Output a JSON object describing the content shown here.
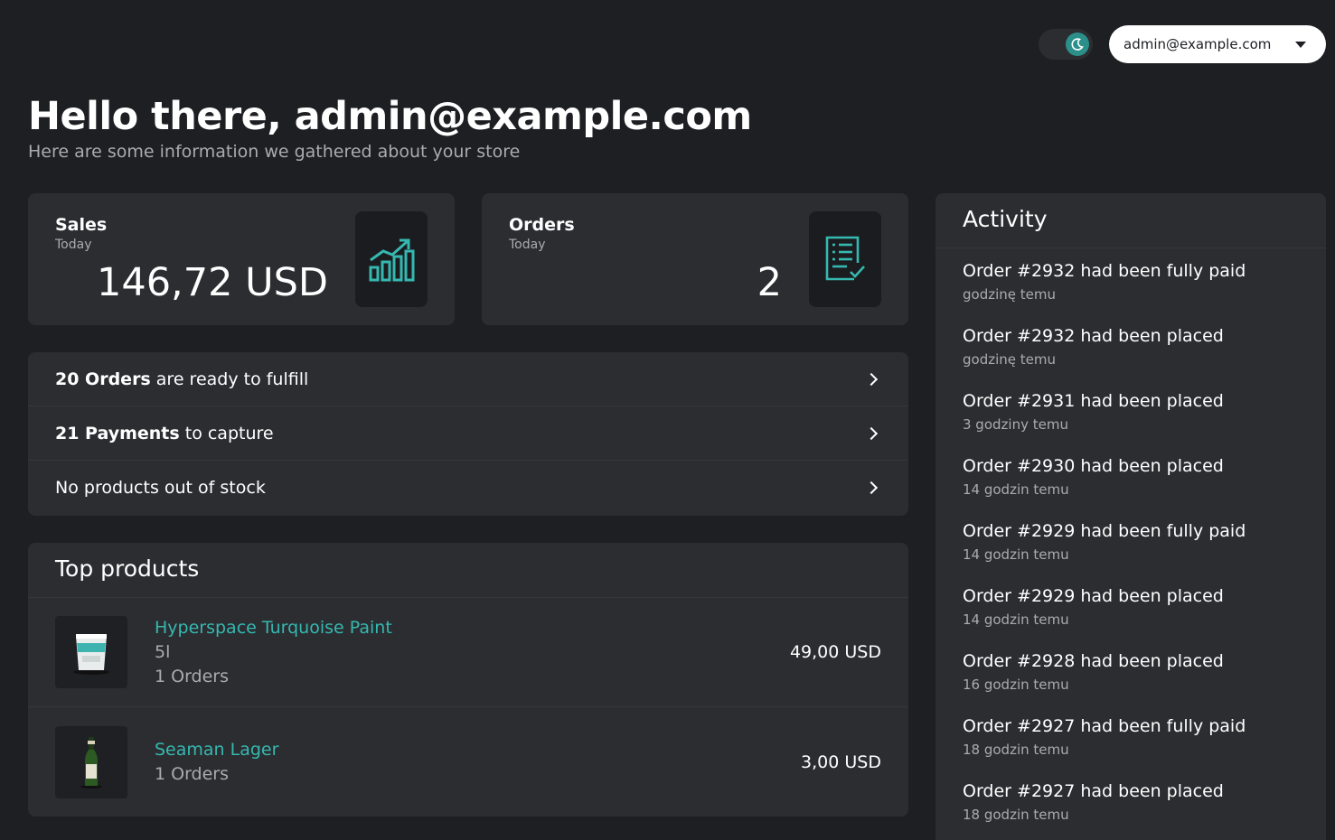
{
  "topbar": {
    "theme_toggle_icon": "moon-icon",
    "user_email": "admin@example.com"
  },
  "header": {
    "greeting": "Hello there, admin@example.com",
    "subtitle": "Here are some information we gathered about your store"
  },
  "stats": {
    "sales": {
      "title": "Sales",
      "period": "Today",
      "value": "146,72 USD",
      "icon": "chart-growth-icon"
    },
    "orders": {
      "title": "Orders",
      "period": "Today",
      "value": "2",
      "icon": "checklist-icon"
    }
  },
  "summary": {
    "fulfill_count": "20 Orders",
    "fulfill_text": " are ready to fulfill",
    "capture_count": "21 Payments",
    "capture_text": " to capture",
    "stock_text": "No products out of stock"
  },
  "top_products": {
    "title": "Top products",
    "items": [
      {
        "name": "Hyperspace Turquoise Paint",
        "variant": "5l",
        "orders": "1 Orders",
        "price": "49,00 USD"
      },
      {
        "name": "Seaman Lager",
        "orders": "1 Orders",
        "price": "3,00 USD"
      }
    ]
  },
  "activity": {
    "title": "Activity",
    "items": [
      {
        "text": "Order #2932 had been fully paid",
        "time": "godzinę temu"
      },
      {
        "text": "Order #2932 had been placed",
        "time": "godzinę temu"
      },
      {
        "text": "Order #2931 had been placed",
        "time": "3 godziny temu"
      },
      {
        "text": "Order #2930 had been placed",
        "time": "14 godzin temu"
      },
      {
        "text": "Order #2929 had been fully paid",
        "time": "14 godzin temu"
      },
      {
        "text": "Order #2929 had been placed",
        "time": "14 godzin temu"
      },
      {
        "text": "Order #2928 had been placed",
        "time": "16 godzin temu"
      },
      {
        "text": "Order #2927 had been fully paid",
        "time": "18 godzin temu"
      },
      {
        "text": "Order #2927 had been placed",
        "time": "18 godzin temu"
      }
    ]
  },
  "colors": {
    "background": "#1e1f23",
    "card": "#2c2d31",
    "accent": "#35b8b0",
    "muted_text": "#a9abb0"
  }
}
